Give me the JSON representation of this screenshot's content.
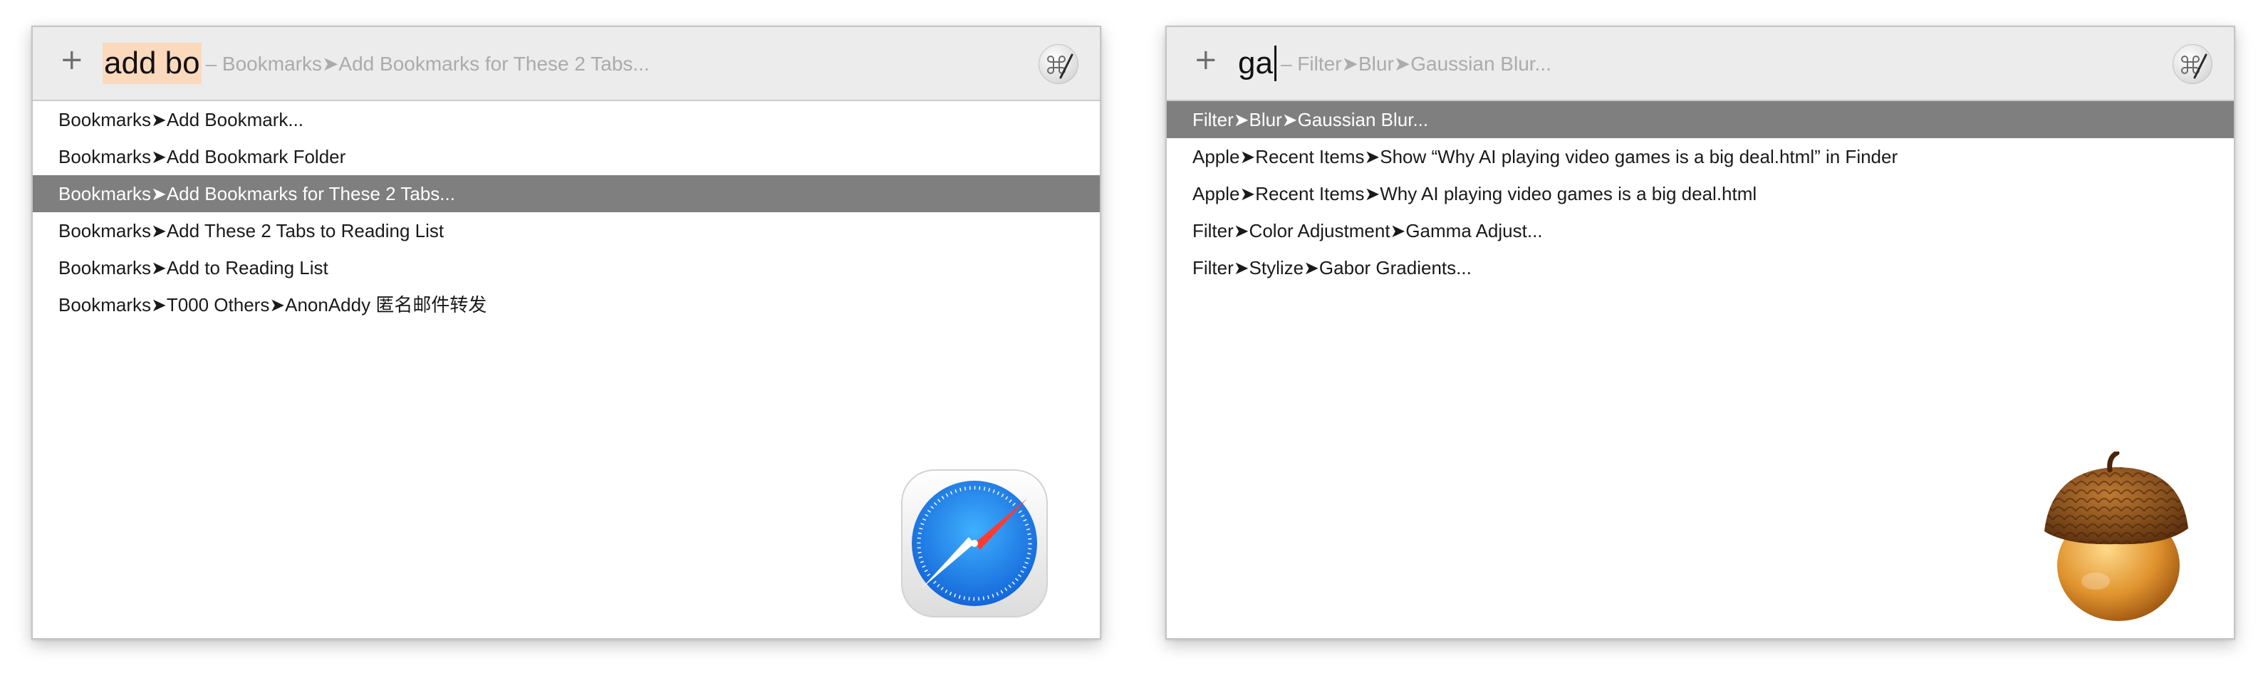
{
  "left_panel": {
    "query_typed": "add bo",
    "query_hint": "– Bookmarks➤Add Bookmarks for These 2 Tabs...",
    "plus_glyph": "+",
    "results": [
      {
        "label": "Bookmarks➤Add Bookmark...",
        "selected": false
      },
      {
        "label": "Bookmarks➤Add Bookmark Folder",
        "selected": false
      },
      {
        "label": "Bookmarks➤Add Bookmarks for These 2 Tabs...",
        "selected": true
      },
      {
        "label": "Bookmarks➤Add These 2 Tabs to Reading List",
        "selected": false
      },
      {
        "label": "Bookmarks➤Add to Reading List",
        "selected": false
      },
      {
        "label": "Bookmarks➤T000 Others➤AnonAddy 匿名邮件转发",
        "selected": false
      }
    ],
    "app_icon": "safari-icon"
  },
  "right_panel": {
    "query_typed": "ga",
    "query_hint": "– Filter➤Blur➤Gaussian Blur...",
    "plus_glyph": "+",
    "results": [
      {
        "label": "Filter➤Blur➤Gaussian Blur...",
        "selected": true
      },
      {
        "label": "Apple➤Recent Items➤Show “Why AI playing video games is a big deal.html” in Finder",
        "selected": false
      },
      {
        "label": "Apple➤Recent Items➤Why AI playing video games is a big deal.html",
        "selected": false
      },
      {
        "label": "Filter➤Color Adjustment➤Gamma Adjust...",
        "selected": false
      },
      {
        "label": "Filter➤Stylize➤Gabor Gradients...",
        "selected": false
      }
    ],
    "app_icon": "acorn-icon"
  },
  "colors": {
    "selection": "#7f7f7f",
    "query_highlight": "#fbd9bd",
    "search_bar": "#ececec",
    "hint_text": "#ababab"
  }
}
